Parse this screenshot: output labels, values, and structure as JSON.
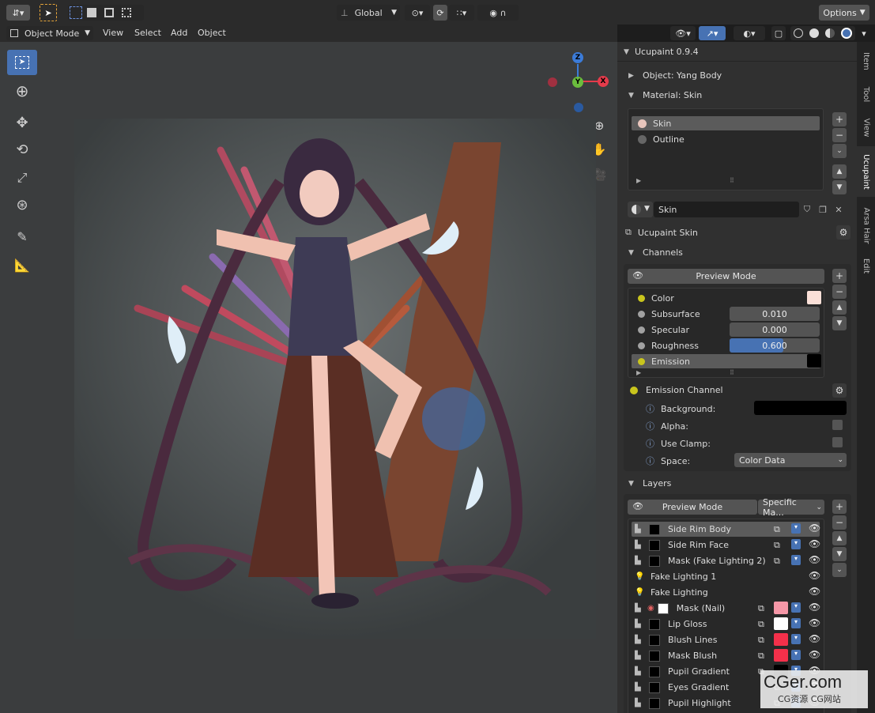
{
  "header": {
    "orientation": "Global",
    "options": "Options",
    "mode": "Object Mode",
    "menus": [
      "View",
      "Select",
      "Add",
      "Object"
    ]
  },
  "panel": {
    "title": "Ucupaint 0.9.4",
    "object": "Object: Yang Body",
    "material": "Material: Skin",
    "materials": [
      "Skin",
      "Outline"
    ],
    "material_name": "Skin",
    "node": "Ucupaint Skin",
    "channels_title": "Channels",
    "channels_preview": "Preview Mode",
    "channels": [
      {
        "name": "Color",
        "dot": "#c9c51d",
        "kind": "swatch",
        "swatch": "#fbe0d8"
      },
      {
        "name": "Subsurface",
        "dot": "#a1a1a1",
        "kind": "value",
        "value": "0.010",
        "fill": 0
      },
      {
        "name": "Specular",
        "dot": "#a1a1a1",
        "kind": "value",
        "value": "0.000",
        "fill": 0
      },
      {
        "name": "Roughness",
        "dot": "#a1a1a1",
        "kind": "value",
        "value": "0.600",
        "fill": 0.6
      },
      {
        "name": "Emission",
        "dot": "#c9c51d",
        "kind": "swatch",
        "swatch": "#000000"
      }
    ],
    "emission": {
      "title": "Emission Channel",
      "bg": "Background:",
      "alpha": "Alpha:",
      "clamp": "Use Clamp:",
      "space": "Space:",
      "space_value": "Color Data"
    },
    "layers_title": "Layers",
    "layers_preview": "Preview Mode",
    "layers_dropdown": "Specific Ma...",
    "layers": [
      {
        "name": "Side Rim Body",
        "thumb": true,
        "indent": true,
        "swatch": ""
      },
      {
        "name": "Side Rim Face",
        "thumb": true,
        "indent": true,
        "swatch": ""
      },
      {
        "name": "Mask (Fake Lighting 2)",
        "thumb": true,
        "indent": true,
        "swatch": ""
      },
      {
        "name": "Fake Lighting 1",
        "thumb": false,
        "indent": false,
        "swatch": ""
      },
      {
        "name": "Fake Lighting",
        "thumb": false,
        "indent": false,
        "swatch": ""
      },
      {
        "name": "Mask (Nail)",
        "thumb": true,
        "indent": true,
        "swatch": "#f597a7",
        "white": true
      },
      {
        "name": "Lip Gloss",
        "thumb": true,
        "indent": true,
        "swatch": "#ffffff"
      },
      {
        "name": "Blush Lines",
        "thumb": true,
        "indent": true,
        "swatch": "#f4304a"
      },
      {
        "name": "Mask Blush",
        "thumb": true,
        "indent": true,
        "swatch": "#f4304a"
      },
      {
        "name": "Pupil Gradient",
        "thumb": true,
        "indent": true,
        "swatch": "#000000"
      },
      {
        "name": "Eyes Gradient",
        "thumb": true,
        "indent": true,
        "swatch": ""
      },
      {
        "name": "Pupil Highlight",
        "thumb": true,
        "indent": true,
        "swatch": ""
      }
    ]
  },
  "tabs": [
    "Item",
    "Tool",
    "View",
    "Ucupaint",
    "Arsa Hair",
    "Edit"
  ],
  "gizmo": {
    "z": "Z",
    "y": "Y",
    "x": "X"
  },
  "watermark": {
    "main": "CGer.com",
    "sub": "CG资源 CG网站"
  }
}
